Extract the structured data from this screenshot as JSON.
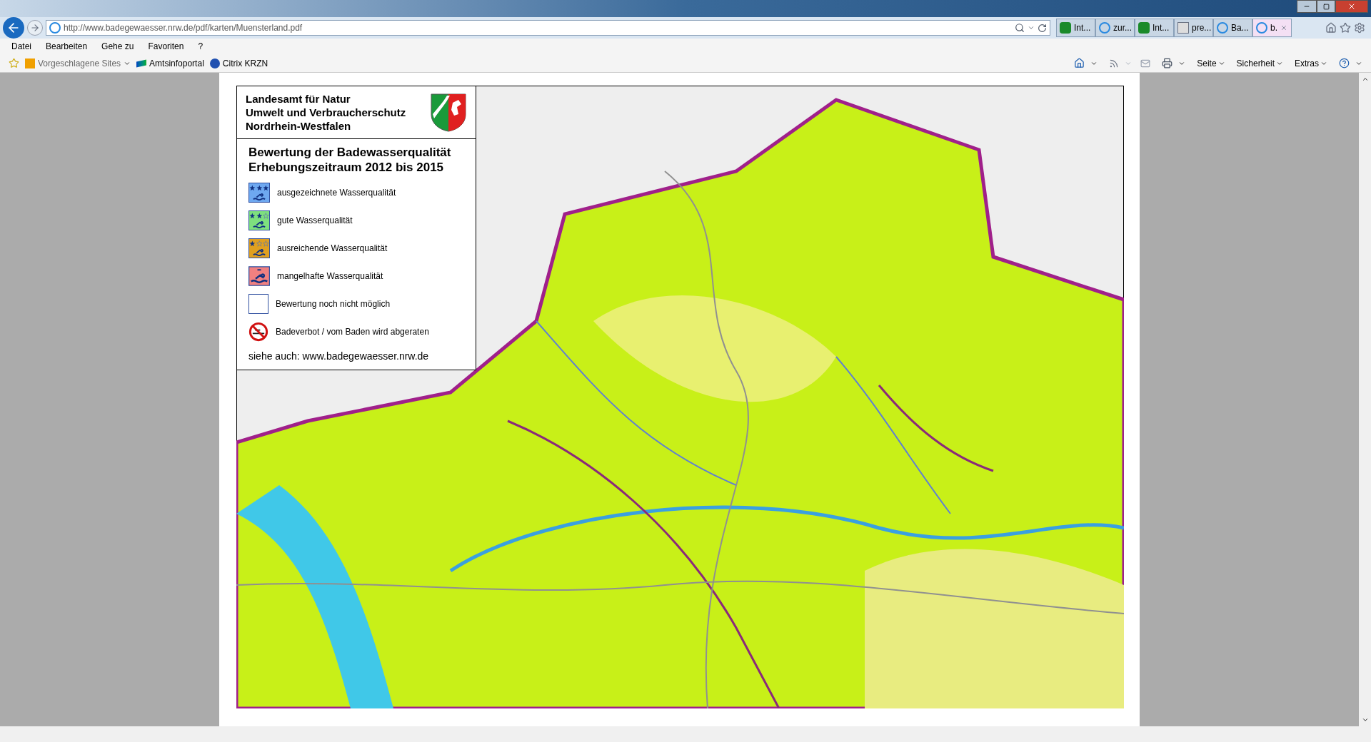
{
  "browser": {
    "address": "http://www.badegewaesser.nrw.de/pdf/karten/Muensterland.pdf",
    "tabs": [
      {
        "label": "Int...",
        "kind": "leaf",
        "selected": false
      },
      {
        "label": "zur...",
        "kind": "browser",
        "selected": false
      },
      {
        "label": "Int...",
        "kind": "leaf",
        "selected": false
      },
      {
        "label": "pre...",
        "kind": "letters",
        "selected": false
      },
      {
        "label": "Ba...",
        "kind": "browser",
        "selected": false
      },
      {
        "label": "b.",
        "kind": "browser",
        "selected": true
      }
    ],
    "menu": [
      "Datei",
      "Bearbeiten",
      "Gehe zu",
      "Favoriten",
      "?"
    ],
    "favorites": [
      {
        "label": "Vorgeschlagene Sites",
        "kind": "dropdown"
      },
      {
        "label": "Amtsinfoportal",
        "kind": "link"
      },
      {
        "label": "Citrix KRZN",
        "kind": "citrix"
      }
    ],
    "command_bar": [
      "Seite",
      "Sicherheit",
      "Extras"
    ]
  },
  "legend": {
    "agency": [
      "Landesamt für Natur",
      "Umwelt und Verbraucherschutz",
      "Nordrhein-Westfalen"
    ],
    "title": [
      "Bewertung der Badewasserqualität",
      "Erhebungszeitraum 2012 bis 2015"
    ],
    "items": [
      {
        "kind": "rating",
        "stars": 3,
        "color": "#6ea8f0",
        "label": "ausgezeichnete Wasserqualität"
      },
      {
        "kind": "rating",
        "stars": 2,
        "color": "#7ee07e",
        "label": "gute Wasserqualität"
      },
      {
        "kind": "rating",
        "stars": 1,
        "color": "#e0a020",
        "label": "ausreichende Wasserqualität"
      },
      {
        "kind": "poor",
        "color": "#f08080",
        "label": "mangelhafte Wasserqualität"
      },
      {
        "kind": "empty",
        "label": "Bewertung noch nicht möglich"
      },
      {
        "kind": "ban",
        "label": "Badeverbot / vom Baden wird abgeraten"
      }
    ],
    "see_also": "siehe auch: www.badegewaesser.nrw.de"
  }
}
